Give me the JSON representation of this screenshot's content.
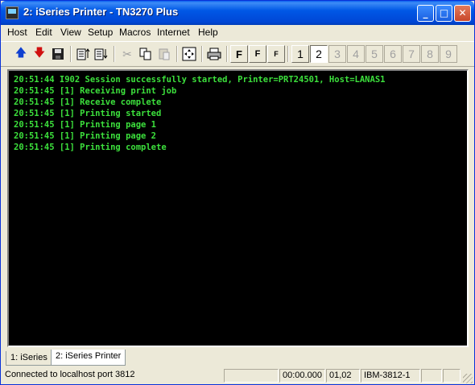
{
  "window": {
    "title": "2: iSeries Printer - TN3270 Plus"
  },
  "menu": [
    "Host",
    "Edit",
    "View",
    "Setup",
    "Macros",
    "Internet",
    "Help"
  ],
  "toolbar": {
    "font_buttons": [
      "F",
      "F",
      "F"
    ],
    "sessions": [
      "1",
      "2",
      "3",
      "4",
      "5",
      "6",
      "7",
      "8",
      "9"
    ],
    "active_session": "2"
  },
  "terminal": {
    "text_color": "#3CE03C",
    "lines": [
      "20:51:44 I902 Session successfully started, Printer=PRT24501, Host=LANAS1",
      "20:51:45 [1] Receiving print job",
      "20:51:45 [1] Receive complete",
      "20:51:45 [1] Printing started",
      "20:51:45 [1] Printing page 1",
      "20:51:45 [1] Printing page 2",
      "20:51:45 [1] Printing complete"
    ]
  },
  "tabs": [
    "1: iSeries",
    "2: iSeries Printer"
  ],
  "status": {
    "message": "Connected to localhost port 3812",
    "timer": "00:00.000",
    "position": "01,02",
    "device": "IBM-3812-1"
  }
}
